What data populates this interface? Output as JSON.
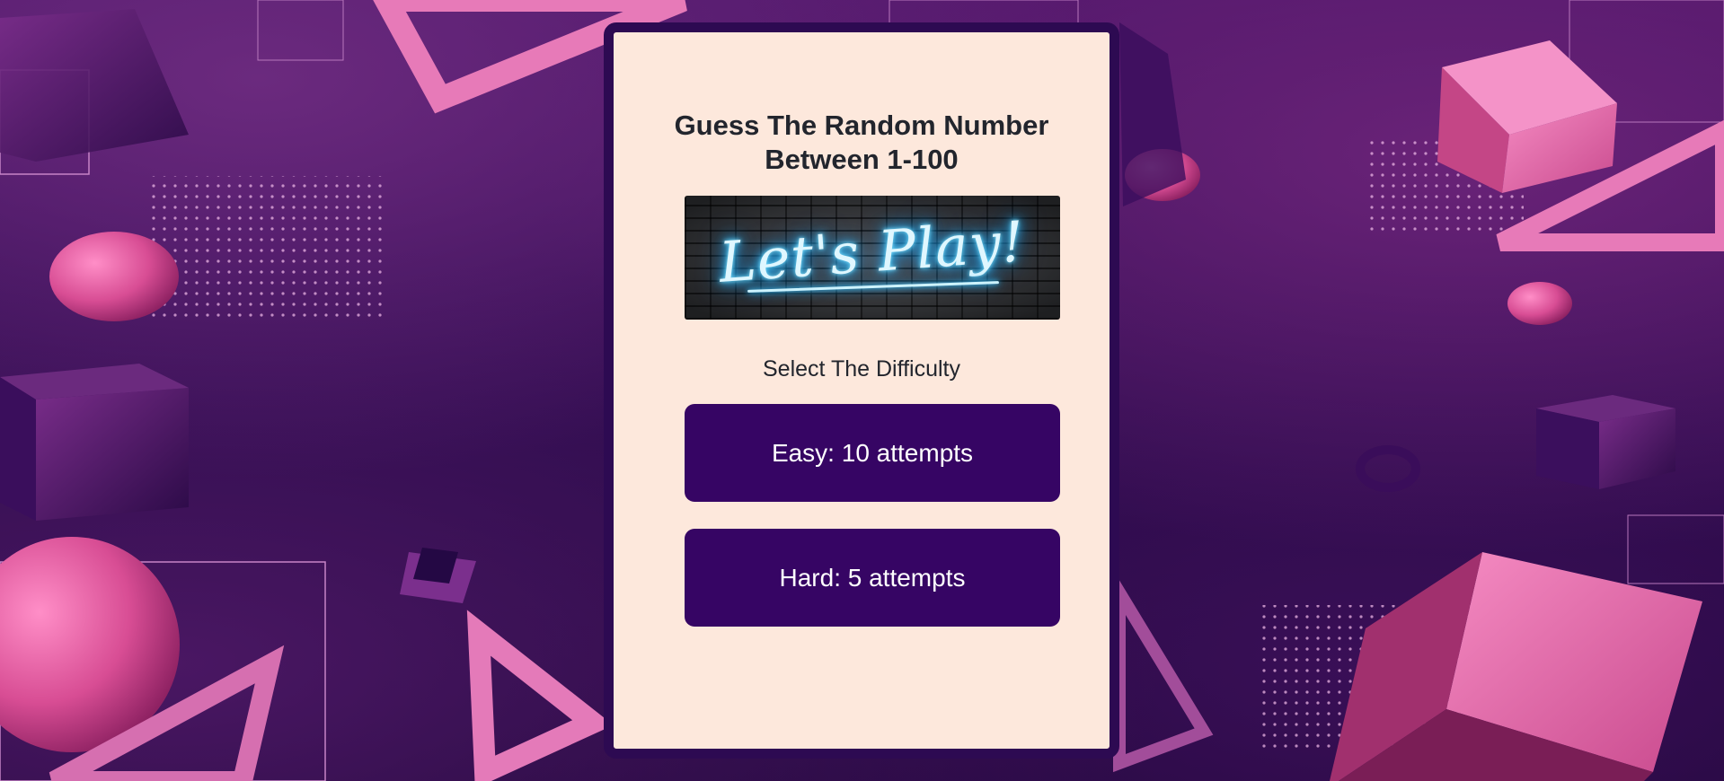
{
  "game": {
    "title_line1": "Guess The Random Number",
    "title_line2": "Between 1-100",
    "banner_text": "Let's Play!",
    "difficulty_prompt": "Select The Difficulty",
    "buttons": {
      "easy_label": "Easy: 10 attempts",
      "hard_label": "Hard: 5 attempts"
    }
  },
  "colors": {
    "card_background": "#fde8dc",
    "card_border": "#2d0a52",
    "button_background": "#360564",
    "button_text": "#ffffff",
    "text_dark": "#22252d",
    "neon_accent": "#38c6ff",
    "background_purple": "#2c0b4c",
    "shape_pink": "#e0579c"
  }
}
